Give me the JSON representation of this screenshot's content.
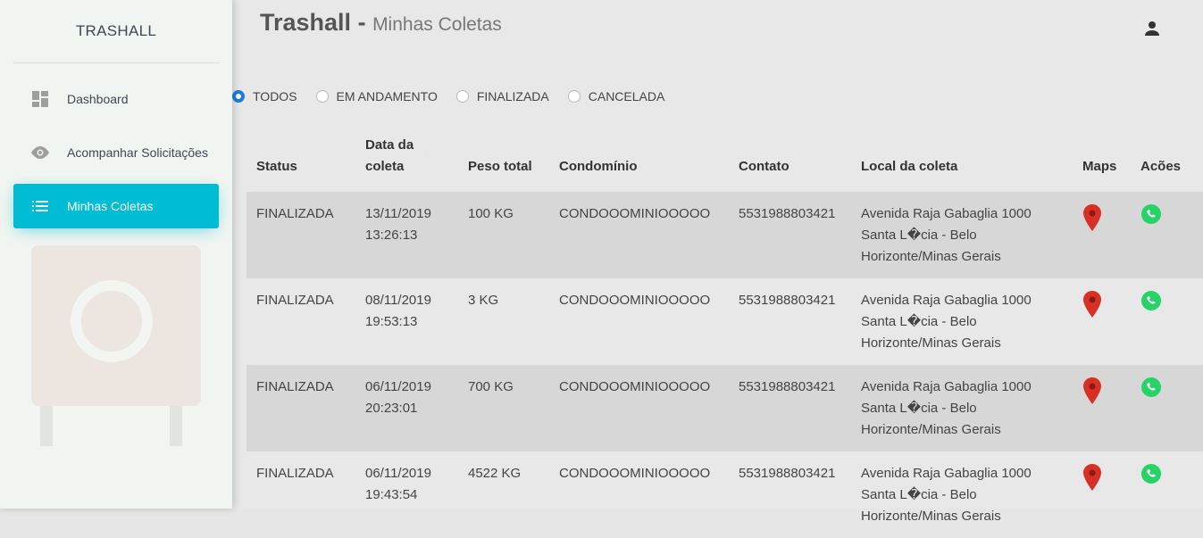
{
  "sidebar": {
    "brand": "TRASHALL",
    "items": [
      {
        "label": "Dashboard",
        "icon": "dashboard-icon"
      },
      {
        "label": "Acompanhar Solicitações",
        "icon": "eye-icon"
      },
      {
        "label": "Minhas Coletas",
        "icon": "list-icon"
      }
    ]
  },
  "header": {
    "title": "Trashall",
    "separator": " - ",
    "subtitle": "Minhas Coletas"
  },
  "filters": [
    {
      "label": "TODOS",
      "checked": true
    },
    {
      "label": "EM ANDAMENTO",
      "checked": false
    },
    {
      "label": "FINALIZADA",
      "checked": false
    },
    {
      "label": "CANCELADA",
      "checked": false
    }
  ],
  "table": {
    "headers": {
      "status": "Status",
      "data_line1": "Data da",
      "data_line2": "coleta",
      "peso": "Peso total",
      "condominio": "Condomínio",
      "contato": "Contato",
      "local": "Local da coleta",
      "maps": "Maps",
      "acoes": "Acões"
    },
    "rows": [
      {
        "status": "FINALIZADA",
        "date": "13/11/2019",
        "time": "13:26:13",
        "peso": "100 KG",
        "condominio": "CONDOOOMINIOOOOO",
        "contato": "5531988803421",
        "local_line1": "Avenida Raja Gabaglia 1000",
        "local_line2": "Santa L�cia - Belo",
        "local_line3": "Horizonte/Minas Gerais"
      },
      {
        "status": "FINALIZADA",
        "date": "08/11/2019",
        "time": "19:53:13",
        "peso": "3 KG",
        "condominio": "CONDOOOMINIOOOOO",
        "contato": "5531988803421",
        "local_line1": "Avenida Raja Gabaglia 1000",
        "local_line2": "Santa L�cia - Belo",
        "local_line3": "Horizonte/Minas Gerais"
      },
      {
        "status": "FINALIZADA",
        "date": "06/11/2019",
        "time": "20:23:01",
        "peso": "700 KG",
        "condominio": "CONDOOOMINIOOOOO",
        "contato": "5531988803421",
        "local_line1": "Avenida Raja Gabaglia 1000",
        "local_line2": "Santa L�cia - Belo",
        "local_line3": "Horizonte/Minas Gerais"
      },
      {
        "status": "FINALIZADA",
        "date": "06/11/2019",
        "time": "19:43:54",
        "peso": "4522 KG",
        "condominio": "CONDOOOMINIOOOOO",
        "contato": "5531988803421",
        "local_line1": "Avenida Raja Gabaglia 1000",
        "local_line2": "Santa L�cia - Belo",
        "local_line3": "Horizonte/Minas Gerais"
      }
    ]
  },
  "colors": {
    "accent": "#00bcd4",
    "radio_checked": "#1a7ee0",
    "map_pin": "#d93025",
    "whatsapp": "#25d366"
  }
}
